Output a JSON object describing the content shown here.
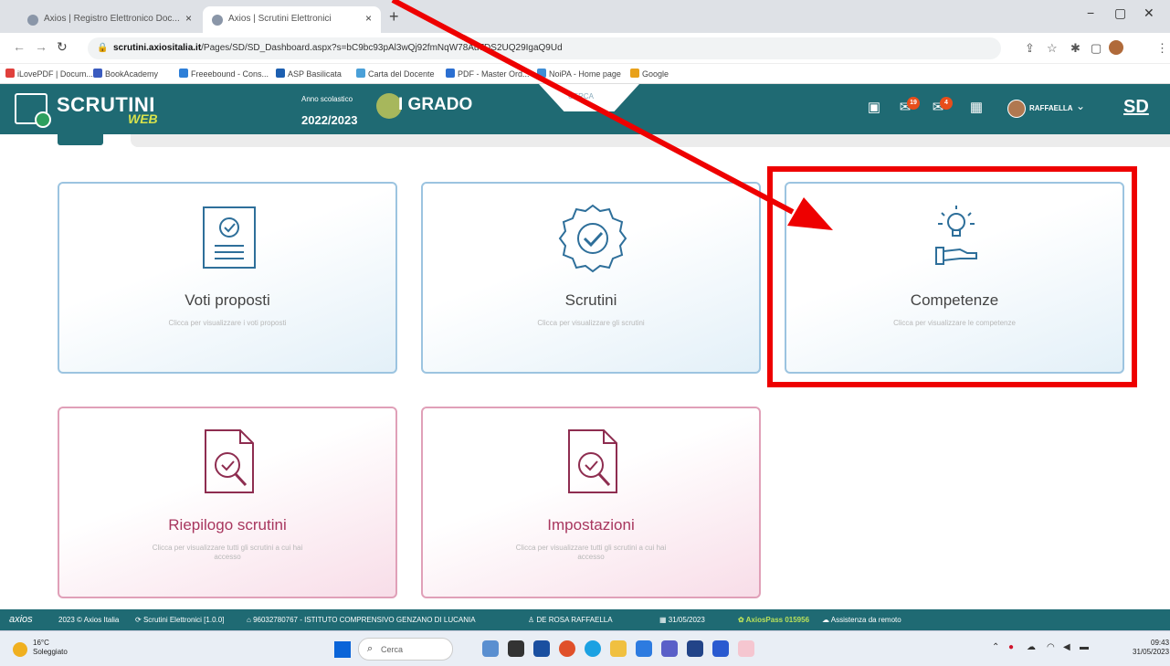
{
  "browser": {
    "tabs": [
      {
        "title": "Axios | Registro Elettronico Doc...",
        "active": false
      },
      {
        "title": "Axios | Scrutini Elettronici",
        "active": true
      }
    ],
    "new_tab": "+",
    "window": {
      "minimize": "−",
      "restore": "▢",
      "close": "✕"
    },
    "url_host": "scrutini.axiositalia.it",
    "url_path": "/Pages/SD/SD_Dashboard.aspx?s=bC9bc93pAl3wQj92fmNqW78Au7DS2UQ29IgaQ9Ud",
    "bookmarks": [
      {
        "label": "iLovePDF | Docum...",
        "color": "#e0403c"
      },
      {
        "label": "BookAcademy",
        "color": "#3a5bbf"
      },
      {
        "label": "Freeebound - Cons...",
        "color": "#2e7fd8"
      },
      {
        "label": "ASP Basilicata",
        "color": "#1d5fb0"
      },
      {
        "label": "Carta del Docente",
        "color": "#4aa0d8"
      },
      {
        "label": "PDF - Master Ord...",
        "color": "#2b6fd1"
      },
      {
        "label": "NoiPA - Home page",
        "color": "#3f8ed6"
      },
      {
        "label": "Google",
        "color": "#e8a11a"
      }
    ]
  },
  "header": {
    "logo_main": "SCRUTINI",
    "logo_sub": "WEB",
    "year_label": "Anno scolastico",
    "year": "2022/2023",
    "grado": "I GRADO",
    "center_tab": "CERCA",
    "badges": {
      "messages": "19",
      "mail": "4"
    },
    "user": "RAFFAELLA",
    "initials": "SD"
  },
  "cards": [
    {
      "title": "Voti proposti",
      "sub": "Clicca per visualizzare i voti proposti",
      "theme": "blue",
      "icon": "document-check-icon"
    },
    {
      "title": "Scrutini",
      "sub": "Clicca per visualizzare gli scrutini",
      "theme": "blue",
      "icon": "badge-check-icon"
    },
    {
      "title": "Competenze",
      "sub": "Clicca per visualizzare le competenze",
      "theme": "blue",
      "icon": "lightbulb-hand-icon"
    },
    {
      "title": "Riepilogo scrutini",
      "sub": "Clicca per visualizzare tutti gli scrutini a cui hai accesso",
      "theme": "pink",
      "icon": "document-search-icon"
    },
    {
      "title": "Impostazioni",
      "sub": "Clicca per visualizzare tutti gli scrutini a cui hai accesso",
      "theme": "pink",
      "icon": "document-search-icon"
    }
  ],
  "footer": {
    "brand": "axios",
    "copyright": "2023 © Axios Italia",
    "app": "Scrutini Elettronici [1.0.0]",
    "school": "96032780767 - ISTITUTO COMPRENSIVO GENZANO DI LUCANIA",
    "teacher": "DE ROSA RAFFAELLA",
    "date": "31/05/2023",
    "pass": "AxiosPass 015956",
    "remote": "Assistenza da remoto"
  },
  "taskbar": {
    "temp": "16°C",
    "weather": "Soleggiato",
    "search": "Cerca",
    "time": "09:43",
    "date": "31/05/2023"
  },
  "colors": {
    "header": "#1f6a73",
    "annotation": "#ee0000",
    "card_blue_border": "#9cc4e0",
    "card_pink_border": "#e0a0b8"
  }
}
